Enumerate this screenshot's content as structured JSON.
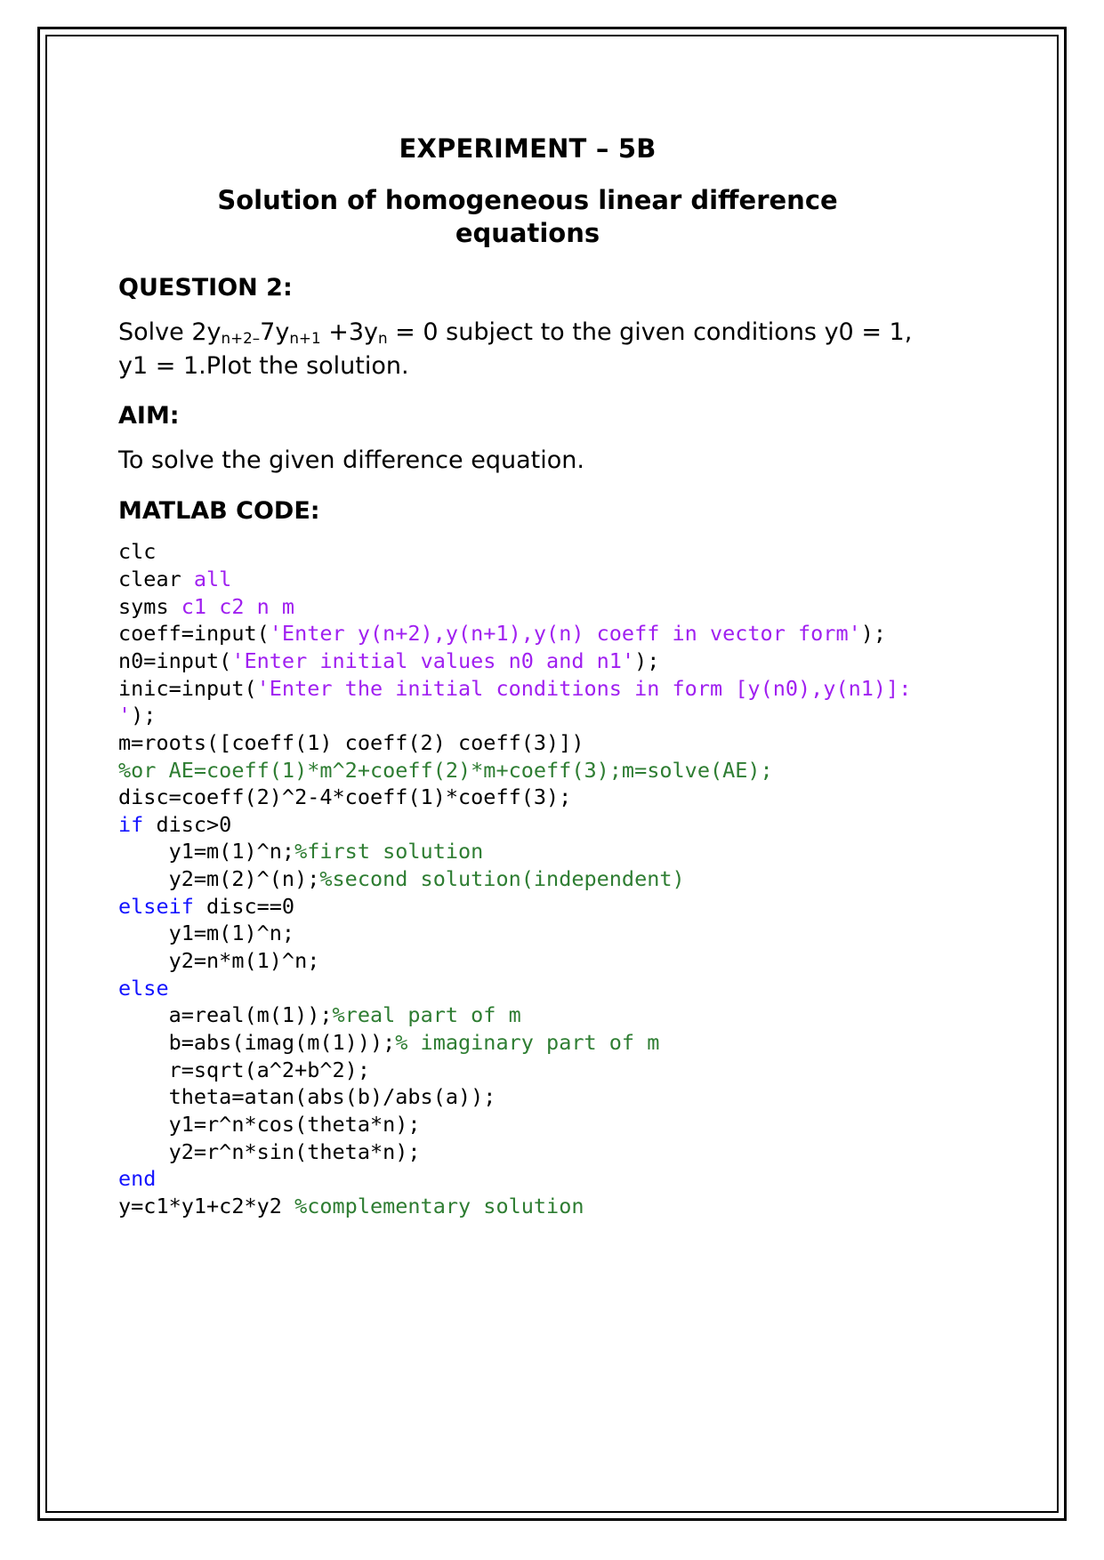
{
  "document": {
    "title": "EXPERIMENT – 5B",
    "subtitle": "Solution of homogeneous linear difference equations",
    "sections": {
      "question_heading": "QUESTION 2:",
      "question_text_prefix": "Solve 2y",
      "question_sub_1": "n+2–",
      "question_mid_1": "7y",
      "question_sub_2": "n+1",
      "question_mid_2": " +3y",
      "question_sub_3": "n",
      "question_tail": " = 0 subject to the given conditions y0 = 1, y1 = 1.Plot the solution.",
      "aim_heading": "AIM:",
      "aim_text": "To solve the given difference equation.",
      "code_heading": "MATLAB CODE:"
    }
  },
  "code": {
    "lines": [
      [
        {
          "t": "clc",
          "c": "plain"
        }
      ],
      [
        {
          "t": "clear ",
          "c": "plain"
        },
        {
          "t": "all",
          "c": "str"
        }
      ],
      [
        {
          "t": "syms ",
          "c": "plain"
        },
        {
          "t": "c1 c2 n m",
          "c": "str"
        }
      ],
      [
        {
          "t": "coeff=input(",
          "c": "plain"
        },
        {
          "t": "'Enter y(n+2),y(n+1),y(n) coeff in vector form'",
          "c": "str"
        },
        {
          "t": ");",
          "c": "plain"
        }
      ],
      [
        {
          "t": "n0=input(",
          "c": "plain"
        },
        {
          "t": "'Enter initial values n0 and n1'",
          "c": "str"
        },
        {
          "t": ");",
          "c": "plain"
        }
      ],
      [
        {
          "t": "inic=input(",
          "c": "plain"
        },
        {
          "t": "'Enter the initial conditions in form [y(n0),y(n1)]: '",
          "c": "str"
        },
        {
          "t": ");",
          "c": "plain"
        }
      ],
      [
        {
          "t": "m=roots([coeff(1) coeff(2) coeff(3)])",
          "c": "plain"
        }
      ],
      [
        {
          "t": "%or AE=coeff(1)*m^2+coeff(2)*m+coeff(3);m=solve(AE);",
          "c": "com"
        }
      ],
      [
        {
          "t": "disc=coeff(2)^2-4*coeff(1)*coeff(3);",
          "c": "plain"
        }
      ],
      [
        {
          "t": "if",
          "c": "key"
        },
        {
          "t": " disc>0",
          "c": "plain"
        }
      ],
      [
        {
          "t": "    y1=m(1)^n;",
          "c": "plain"
        },
        {
          "t": "%first solution",
          "c": "com"
        }
      ],
      [
        {
          "t": "    y2=m(2)^(n);",
          "c": "plain"
        },
        {
          "t": "%second solution(independent)",
          "c": "com"
        }
      ],
      [
        {
          "t": "elseif",
          "c": "key"
        },
        {
          "t": " disc==0",
          "c": "plain"
        }
      ],
      [
        {
          "t": "    y1=m(1)^n;",
          "c": "plain"
        }
      ],
      [
        {
          "t": "    y2=n*m(1)^n;",
          "c": "plain"
        }
      ],
      [
        {
          "t": "else",
          "c": "key"
        }
      ],
      [
        {
          "t": "    a=real(m(1));",
          "c": "plain"
        },
        {
          "t": "%real part of m",
          "c": "com"
        }
      ],
      [
        {
          "t": "    b=abs(imag(m(1)));",
          "c": "plain"
        },
        {
          "t": "% imaginary part of m",
          "c": "com"
        }
      ],
      [
        {
          "t": "    r=sqrt(a^2+b^2);",
          "c": "plain"
        }
      ],
      [
        {
          "t": "    theta=atan(abs(b)/abs(a));",
          "c": "plain"
        }
      ],
      [
        {
          "t": "    y1=r^n*cos(theta*n);",
          "c": "plain"
        }
      ],
      [
        {
          "t": "    y2=r^n*sin(theta*n);",
          "c": "plain"
        }
      ],
      [
        {
          "t": "end",
          "c": "key"
        }
      ],
      [
        {
          "t": "y=c1*y1+c2*y2 ",
          "c": "plain"
        },
        {
          "t": "%complementary solution",
          "c": "com"
        }
      ]
    ]
  },
  "colors": {
    "string": "#a020f0",
    "comment": "#2e7d32",
    "keyword": "#1414ff",
    "text": "#000000",
    "background": "#ffffff"
  }
}
